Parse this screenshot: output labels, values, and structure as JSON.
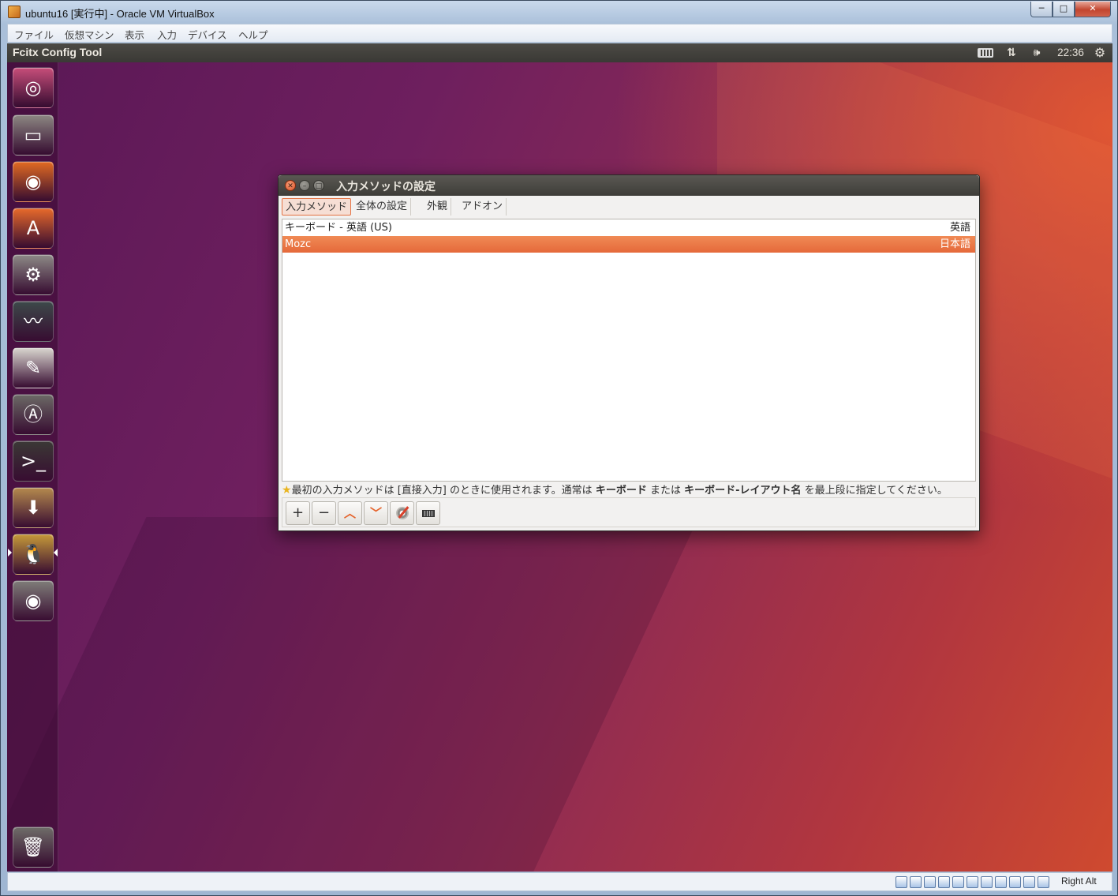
{
  "host": {
    "title": "ubuntu16 [実行中] - Oracle VM VirtualBox",
    "menu": [
      "ファイル",
      "仮想マシン",
      "表示",
      "入力",
      "デバイス",
      "ヘルプ"
    ],
    "controls": {
      "minimize": "─",
      "maximize": "□",
      "close": "✕"
    },
    "status_host_key": "Right Alt",
    "status_icons": [
      "hard-disk-icon",
      "optical-drive-icon",
      "audio-icon",
      "network-icon",
      "usb-icon",
      "shared-folders-icon",
      "display-icon",
      "video-capture-icon",
      "virtualization-icon",
      "mouse-integration-icon",
      "keyboard-capture-icon"
    ]
  },
  "panel": {
    "title": "Fcitx Config Tool",
    "clock": "22:36",
    "icons": {
      "keyboard": "keyboard-icon",
      "network": "⇅",
      "volume": "🕪",
      "power": "⚙"
    }
  },
  "launcher": {
    "items": [
      {
        "name": "launcher-dash-icon",
        "glyph": "◎",
        "bg": "#c74e7a"
      },
      {
        "name": "launcher-files-icon",
        "glyph": "▭",
        "bg": "#8c8782"
      },
      {
        "name": "launcher-firefox-icon",
        "glyph": "◉",
        "bg": "#e26b22"
      },
      {
        "name": "launcher-software-center-icon",
        "glyph": "A",
        "bg": "#e86a2b"
      },
      {
        "name": "launcher-system-settings-icon",
        "glyph": "⚙",
        "bg": "#8d8a86"
      },
      {
        "name": "launcher-system-monitor-icon",
        "glyph": "〰",
        "bg": "#3d4a4a"
      },
      {
        "name": "launcher-text-editor-icon",
        "glyph": "✎",
        "bg": "#d9d6cf"
      },
      {
        "name": "launcher-software-updater-icon",
        "glyph": "Ⓐ",
        "bg": "#6c6a66"
      },
      {
        "name": "launcher-terminal-icon",
        "glyph": ">_",
        "bg": "#3b3936"
      },
      {
        "name": "launcher-archive-manager-icon",
        "glyph": "⬇",
        "bg": "#b58a4e"
      },
      {
        "name": "launcher-fcitx-icon",
        "glyph": "🐧",
        "bg": "#c69a3a"
      },
      {
        "name": "launcher-optical-disc-icon",
        "glyph": "◉",
        "bg": "#7f7d79"
      },
      {
        "name": "launcher-trash-icon",
        "glyph": "🗑",
        "bg": "#6f6d69"
      }
    ]
  },
  "dialog": {
    "title": "入力メソッドの設定",
    "window_buttons": {
      "close": "✕",
      "minimize": "–",
      "maximize": "□"
    },
    "tabs": [
      "入力メソッド",
      "全体の設定",
      "外観",
      "アドオン"
    ],
    "rows": [
      {
        "name": "キーボード - 英語 (US)",
        "lang": "英語",
        "selected": false
      },
      {
        "name": "Mozc",
        "lang": "日本語",
        "selected": true
      }
    ],
    "hint": {
      "star": "★",
      "p1": "最初の入力メソッドは [直接入力] のときに使用されます。通常は ",
      "b1": "キーボード",
      "p2": " または ",
      "b2": "キーボード-レイアウト名",
      "p3": " を最上段に指定してください。"
    },
    "toolbar": {
      "add": "+",
      "remove": "−",
      "up": "︿",
      "down": "﹀"
    }
  }
}
